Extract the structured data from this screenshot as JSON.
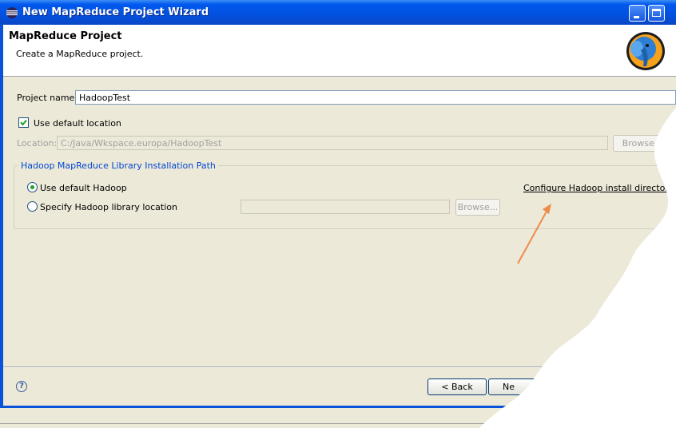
{
  "window": {
    "title": "New MapReduce Project Wizard"
  },
  "header": {
    "title": "MapReduce Project",
    "subtitle": "Create a MapReduce project."
  },
  "project": {
    "name_label": "Project name:",
    "name_value": "HadoopTest"
  },
  "location": {
    "use_default_label": "Use default location",
    "use_default_checked": true,
    "label": "Location:",
    "value": "C:/Java/Wkspace.europa/HadoopTest",
    "browse_label": "Browse..."
  },
  "hadoop_group": {
    "title": "Hadoop MapReduce Library Installation Path",
    "use_default_label": "Use default Hadoop",
    "specify_label": "Specify Hadoop library location",
    "selected": "use_default",
    "configure_link": "Configure Hadoop install directory...",
    "browse_label": "Browse..."
  },
  "footer": {
    "back_label": "< Back",
    "next_label_visible": "Ne"
  },
  "colors": {
    "titlebar": "#0058ee",
    "dialog_bg": "#ece9d8",
    "link_group_title": "#0046d5",
    "annotation_arrow": "#f08a4b"
  },
  "icons": {
    "title": "eclipse-icon",
    "header": "hadoop-elephant-icon",
    "help": "help-icon"
  }
}
